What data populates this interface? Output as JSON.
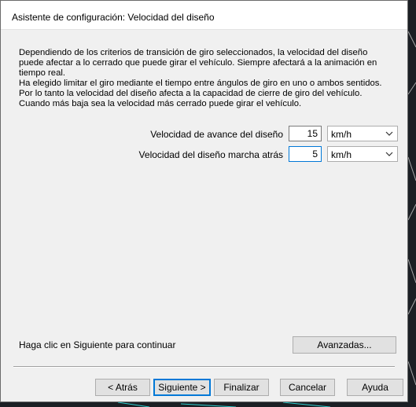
{
  "window": {
    "title": "Asistente de configuración: Velocidad del diseño"
  },
  "description": {
    "para1": "Dependiendo de los criterios de transición de giro seleccionados, la velocidad del diseño puede afectar a lo cerrado que puede girar el vehículo. Siempre afectará a la animación en tiempo real.",
    "para2": "Ha elegido limitar el giro mediante el tiempo entre ángulos de giro en uno o ambos sentidos. Por lo tanto la velocidad del diseño afecta a la capacidad de cierre de giro del vehículo. Cuando más baja sea la velocidad más cerrado puede girar el vehículo."
  },
  "fields": {
    "forward": {
      "label": "Velocidad de avance del diseño",
      "value": "15",
      "unit": "km/h"
    },
    "reverse": {
      "label": "Velocidad del diseño marcha atrás",
      "value": "5",
      "unit": "km/h"
    }
  },
  "footer": {
    "hint": "Haga clic en Siguiente para continuar",
    "advanced_label": "Avanzadas...",
    "back_label": "< Atrás",
    "next_label": "Siguiente >",
    "finish_label": "Finalizar",
    "cancel_label": "Cancelar",
    "help_label": "Ayuda"
  }
}
